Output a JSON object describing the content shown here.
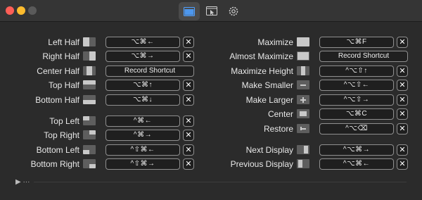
{
  "window": {
    "toolbar_tabs": [
      {
        "icon": "window-layout-icon",
        "active": true
      },
      {
        "icon": "cursor-window-icon",
        "active": false
      },
      {
        "icon": "gear-icon",
        "active": false
      }
    ]
  },
  "left_column": [
    {
      "label": "Left Half",
      "icon": "left-half-icon",
      "shortcut": "⌥⌘←",
      "has_clear": true
    },
    {
      "label": "Right Half",
      "icon": "right-half-icon",
      "shortcut": "⌥⌘→",
      "has_clear": true
    },
    {
      "label": "Center Half",
      "icon": "center-half-icon",
      "shortcut": "Record Shortcut",
      "has_clear": false
    },
    {
      "label": "Top Half",
      "icon": "top-half-icon",
      "shortcut": "⌥⌘↑",
      "has_clear": true
    },
    {
      "label": "Bottom Half",
      "icon": "bottom-half-icon",
      "shortcut": "⌥⌘↓",
      "has_clear": true
    },
    {
      "label": "Top Left",
      "icon": "top-left-icon",
      "shortcut": "^⌘←",
      "has_clear": true
    },
    {
      "label": "Top Right",
      "icon": "top-right-icon",
      "shortcut": "^⌘→",
      "has_clear": true
    },
    {
      "label": "Bottom Left",
      "icon": "bottom-left-icon",
      "shortcut": "^⇧⌘←",
      "has_clear": true
    },
    {
      "label": "Bottom Right",
      "icon": "bottom-right-icon",
      "shortcut": "^⇧⌘→",
      "has_clear": true
    }
  ],
  "right_column": [
    {
      "label": "Maximize",
      "icon": "maximize-icon",
      "shortcut": "⌥⌘F",
      "has_clear": true
    },
    {
      "label": "Almost Maximize",
      "icon": "almost-maximize-icon",
      "shortcut": "Record Shortcut",
      "has_clear": false
    },
    {
      "label": "Maximize Height",
      "icon": "maximize-height-icon",
      "shortcut": "^⌥⇧↑",
      "has_clear": true
    },
    {
      "label": "Make Smaller",
      "icon": "make-smaller-icon",
      "shortcut": "^⌥⇧←",
      "has_clear": true
    },
    {
      "label": "Make Larger",
      "icon": "make-larger-icon",
      "shortcut": "^⌥⇧→",
      "has_clear": true
    },
    {
      "label": "Center",
      "icon": "center-icon",
      "shortcut": "⌥⌘C",
      "has_clear": true
    },
    {
      "label": "Restore",
      "icon": "restore-icon",
      "shortcut": "^⌥⌫",
      "has_clear": true
    },
    {
      "label": "Next Display",
      "icon": "next-display-icon",
      "shortcut": "^⌥⌘→",
      "has_clear": true
    },
    {
      "label": "Previous Display",
      "icon": "previous-display-icon",
      "shortcut": "^⌥⌘←",
      "has_clear": true
    }
  ],
  "clear_glyph": "✕",
  "footer": {
    "disclosure": "▶ ···"
  }
}
